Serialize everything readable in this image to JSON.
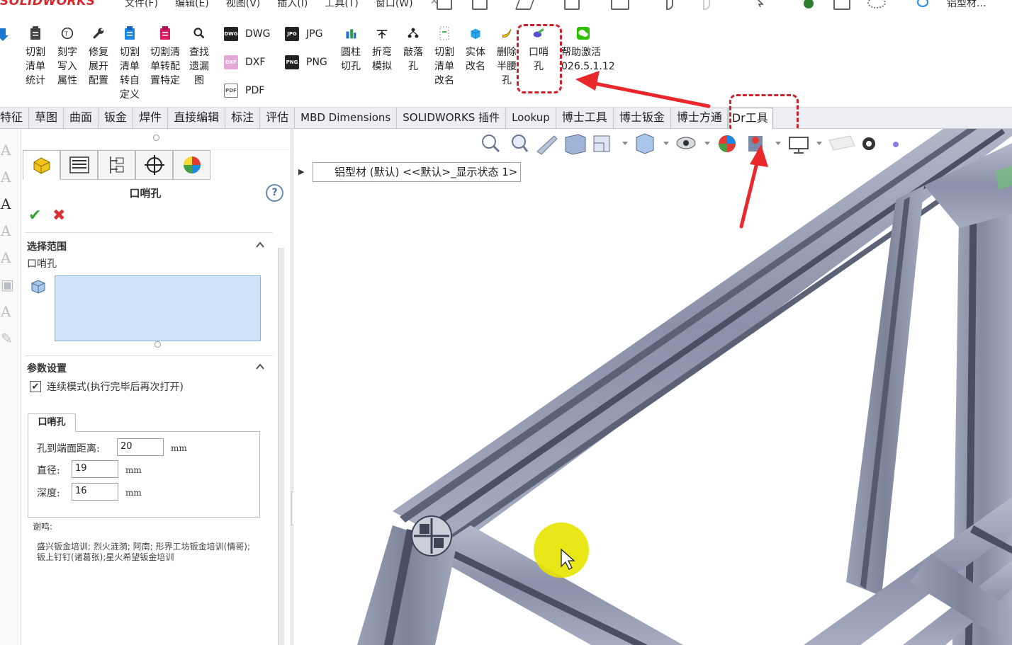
{
  "app": {
    "logo_text": "SOLIDWORKS",
    "menus": [
      "文件(F)",
      "编辑(E)",
      "视图(V)",
      "插入(I)",
      "工具(T)",
      "窗口(W)"
    ],
    "document_name": "铝型材..."
  },
  "ribbon": {
    "buttons": [
      {
        "label": "切割\n清单\n统计",
        "icon": "cutlist-stats-icon"
      },
      {
        "label": "刻字\n写入\n属性",
        "icon": "engrave-icon"
      },
      {
        "label": "修复\n展开\n配置",
        "icon": "wrench-icon"
      },
      {
        "label": "切割\n清单\n转自\n定义",
        "icon": "clipboard-icon"
      },
      {
        "label": "切割清\n单转配\n置特定",
        "icon": "clipboard-pink-icon"
      },
      {
        "label": "查找\n遗漏\n图",
        "icon": "magnifier-icon"
      },
      {
        "label": "圆柱\n切孔",
        "icon": "cylinder-cut-icon"
      },
      {
        "label": "折弯\n模拟",
        "icon": "bend-sim-icon"
      },
      {
        "label": "敲落\n孔",
        "icon": "knockout-icon"
      },
      {
        "label": "切割\n清单\n改名",
        "icon": "cutlist-rename-icon"
      },
      {
        "label": "实体\n改名",
        "icon": "body-rename-icon"
      },
      {
        "label": "删除\n半腰\n孔",
        "icon": "banana-icon"
      },
      {
        "label": "口哨\n孔",
        "icon": "whistle-hole-icon"
      },
      {
        "label": "帮助激活\n026.5.1.12",
        "icon": "wechat-icon"
      }
    ],
    "formats": {
      "dwg": "DWG",
      "dxf": "DXF",
      "pdf": "PDF",
      "jpg": "JPG",
      "png": "PNG"
    }
  },
  "tabs": [
    "特征",
    "草图",
    "曲面",
    "钣金",
    "焊件",
    "直接编辑",
    "标注",
    "评估",
    "MBD Dimensions",
    "SOLIDWORKS 插件",
    "Lookup",
    "博士工具",
    "博士钣金",
    "博士方通",
    "Dr工具"
  ],
  "active_tab_index": 14,
  "property_manager": {
    "title": "口哨孔",
    "help": "?",
    "ok": "✔",
    "cancel": "✖",
    "section_selection": "选择范围",
    "selection_label": "口哨孔",
    "section_params": "参数设置",
    "continuous_mode": "连续模式(执行完毕后再次打开)",
    "continuous_checked": true,
    "group_tab": "口哨孔",
    "params": {
      "distance_label": "孔到端面距离:",
      "distance_value": "20",
      "diameter_label": "直径:",
      "diameter_value": "19",
      "depth_label": "深度:",
      "depth_value": "16",
      "unit": "mm"
    },
    "thanks_title": "谢鸣:",
    "thanks_text": "盛兴钣金培训;  烈火涟漪;  阿南;  形界工坊钣金培训(情哥);钣上钉钉(诸葛张);星火希望钣金培训"
  },
  "feature_tree": {
    "root_label": "铝型材 (默认) <<默认>_显示状态 1>"
  },
  "colors": {
    "accent_red": "#d0202a",
    "selection_fill": "#cfe3f7",
    "cursor_halo": "#e8e400",
    "frame_metal": "#8a91a8"
  }
}
